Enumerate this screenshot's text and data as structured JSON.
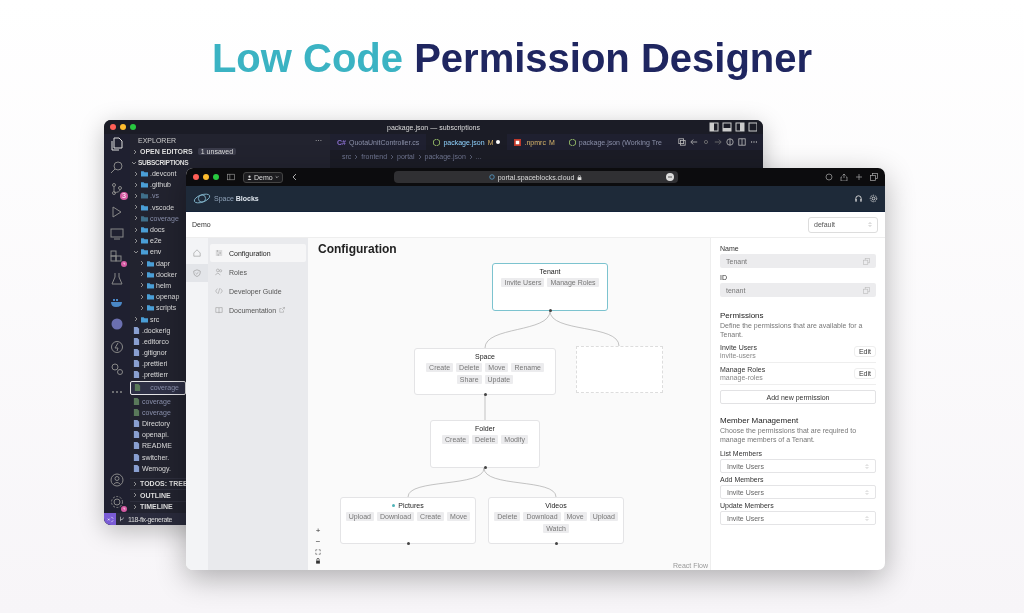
{
  "headline": {
    "highlight": "Low Code",
    "rest": "Permission Designer"
  },
  "editor": {
    "title": "package.json — subscriptions",
    "source_control_badge": "3",
    "explorer_title": "EXPLORER",
    "explorer_more": "···",
    "open_editors": {
      "label": "OPEN EDITORS",
      "badge": "1 unsaved"
    },
    "root": {
      "label": "SUBSCRIPTIONS",
      "expanded": true
    },
    "tabs": [
      {
        "label": "QuotaUnitController.cs",
        "kind": "csharp",
        "icon_text": "C#",
        "dirty": false,
        "selected": false
      },
      {
        "label": "package.json",
        "kind": "json",
        "status": "M",
        "dirty": true,
        "selected": true
      },
      {
        "label": ".npmrc",
        "kind": "npm",
        "status": "M",
        "dirty": false,
        "selected": false
      },
      {
        "label": "package.json (Working Tre",
        "kind": "json",
        "dirty": false,
        "selected": false
      }
    ],
    "breadcrumb": [
      "src",
      "frontend",
      "portal",
      "package.json",
      "..."
    ],
    "tree": [
      {
        "label": ".devcont",
        "kind": "folder",
        "expanded": false,
        "ignored": false,
        "selected": false
      },
      {
        "label": ".github",
        "kind": "folder",
        "expanded": false,
        "ignored": false,
        "selected": false
      },
      {
        "label": ".vs",
        "kind": "folder",
        "expanded": false,
        "ignored": true,
        "selected": false
      },
      {
        "label": ".vscode",
        "kind": "folder",
        "expanded": false,
        "ignored": false,
        "selected": false
      },
      {
        "label": "coverage",
        "kind": "folder",
        "expanded": false,
        "ignored": true,
        "selected": false
      },
      {
        "label": "docs",
        "kind": "folder",
        "expanded": false,
        "ignored": false,
        "selected": false
      },
      {
        "label": "e2e",
        "kind": "folder",
        "expanded": false,
        "ignored": false,
        "selected": false
      },
      {
        "label": "env",
        "kind": "folder",
        "expanded": true,
        "ignored": false,
        "selected": false,
        "children": [
          {
            "label": "dapr",
            "kind": "folder",
            "expanded": false,
            "ignored": false,
            "selected": false
          },
          {
            "label": "docker",
            "kind": "folder",
            "expanded": false,
            "ignored": false,
            "selected": false
          },
          {
            "label": "helm",
            "kind": "folder",
            "expanded": false,
            "ignored": false,
            "selected": false
          },
          {
            "label": "openap",
            "kind": "folder",
            "expanded": false,
            "ignored": false,
            "selected": false
          },
          {
            "label": "scripts",
            "kind": "folder",
            "expanded": false,
            "ignored": false,
            "selected": false
          }
        ]
      },
      {
        "label": "src",
        "kind": "folder",
        "expanded": false,
        "ignored": false,
        "selected": false
      },
      {
        "label": ".dockerig",
        "kind": "file",
        "expanded": false,
        "ignored": false,
        "selected": false
      },
      {
        "label": ".editorco",
        "kind": "file",
        "expanded": false,
        "ignored": false,
        "selected": false
      },
      {
        "label": ".gitignor",
        "kind": "file",
        "expanded": false,
        "ignored": false,
        "selected": false
      },
      {
        "label": ".prettieri",
        "kind": "file",
        "expanded": false,
        "ignored": false,
        "selected": false
      },
      {
        "label": ".prettierr",
        "kind": "file",
        "expanded": false,
        "ignored": false,
        "selected": false
      },
      {
        "label": "coverage",
        "kind": "file",
        "expanded": false,
        "ignored": true,
        "selected": true
      },
      {
        "label": "coverage",
        "kind": "file",
        "expanded": false,
        "ignored": true,
        "selected": false
      },
      {
        "label": "coverage",
        "kind": "file",
        "expanded": false,
        "ignored": true,
        "selected": false
      },
      {
        "label": "Directory",
        "kind": "file",
        "expanded": false,
        "ignored": false,
        "selected": false
      },
      {
        "label": "openapi.",
        "kind": "file",
        "expanded": false,
        "ignored": false,
        "selected": false
      },
      {
        "label": "README",
        "kind": "file",
        "expanded": false,
        "ignored": false,
        "selected": false
      },
      {
        "label": "switcher.",
        "kind": "file",
        "expanded": false,
        "ignored": false,
        "selected": false
      },
      {
        "label": "Wemogy.",
        "kind": "file",
        "expanded": false,
        "ignored": false,
        "selected": false
      }
    ],
    "sections": [
      {
        "label": "TODOS: TREE",
        "expanded": false
      },
      {
        "label": "OUTLINE",
        "expanded": false
      },
      {
        "label": "TIMELINE",
        "expanded": false
      }
    ],
    "status_bar": {
      "branch": "118-fix-generate"
    }
  },
  "browser": {
    "profile": "Demo",
    "url": "portal.spaceblocks.cloud"
  },
  "app": {
    "logo": "Space **Blocks**",
    "breadcrumb": "Demo",
    "environment_select": "default",
    "rail": [
      {
        "selected": false
      },
      {
        "selected": true
      }
    ],
    "nav": [
      {
        "label": "Configuration",
        "external": false,
        "selected": true
      },
      {
        "label": "Roles",
        "external": false,
        "selected": false
      },
      {
        "label": "Developer Guide",
        "external": false,
        "selected": false
      },
      {
        "label": "Documentation",
        "external": true,
        "selected": false
      }
    ],
    "canvas": {
      "title": "Configuration",
      "attribution": "React Flow",
      "nodes": [
        {
          "kind": "node",
          "title": "Tenant",
          "selected": true,
          "dot": false,
          "permissions": [
            "Invite Users",
            "Manage Roles"
          ]
        },
        {
          "kind": "node",
          "title": "Space",
          "selected": false,
          "dot": false,
          "permissions": [
            "Create",
            "Delete",
            "Move",
            "Rename",
            "Share",
            "Update"
          ]
        },
        {
          "kind": "placeholder"
        },
        {
          "kind": "node",
          "title": "Folder",
          "selected": false,
          "dot": false,
          "permissions": [
            "Create",
            "Delete",
            "Modify"
          ]
        },
        {
          "kind": "node",
          "title": "Pictures",
          "selected": false,
          "dot": true,
          "permissions": [
            "Upload",
            "Download",
            "Create",
            "Move"
          ]
        },
        {
          "kind": "node",
          "title": "Videos",
          "selected": false,
          "dot": false,
          "permissions": [
            "Delete",
            "Download",
            "Move",
            "Upload",
            "Watch"
          ]
        }
      ],
      "controls": [
        "+",
        "−"
      ]
    },
    "details": {
      "name_label": "Name",
      "name_value": "Tenant",
      "id_label": "ID",
      "id_value": "tenant",
      "permissions_title": "Permissions",
      "permissions_description": "Define the permissions that are available for a Tenant.",
      "permissions": [
        {
          "name": "Invite Users",
          "key": "invite-users",
          "action": "Edit"
        },
        {
          "name": "Manage Roles",
          "key": "manage-roles",
          "action": "Edit"
        }
      ],
      "add_button": "Add new permission",
      "members_title": "Member Management",
      "members_description": "Choose the permissions that are required to manage members of a Tenant.",
      "member_settings": [
        {
          "label": "List Members",
          "value": "Invite Users"
        },
        {
          "label": "Add Members",
          "value": "Invite Users"
        },
        {
          "label": "Update Members",
          "value": "Invite Users"
        }
      ]
    }
  }
}
